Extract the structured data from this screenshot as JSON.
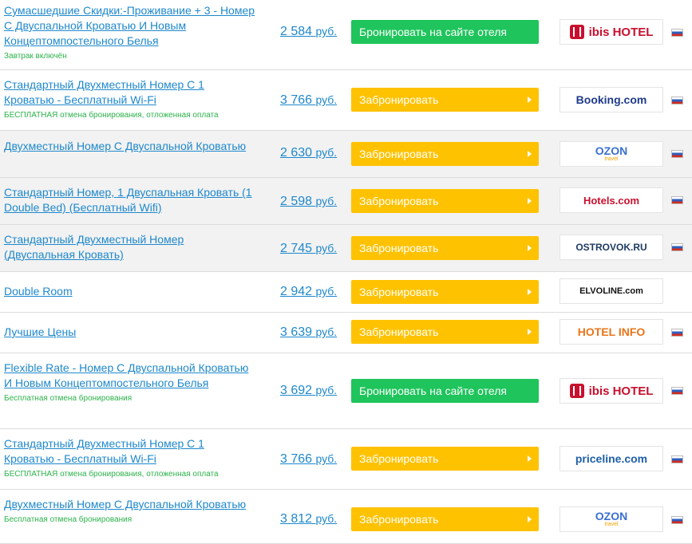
{
  "rows": [
    {
      "room": "Сумасшедшие Скидки:-Проживание + 3 - Номер С Двуспальной Кроватью И Новым Концептомпостельного Белья",
      "note": "Завтрак включён",
      "price": "2 584",
      "currency": "руб.",
      "button": "Бронировать на сайте отеля",
      "button_color": "#1fc45c",
      "logo": "ibis HOTEL",
      "logo_icon": "ibis-logo",
      "flag": true,
      "alt": false
    },
    {
      "room": "Стандартный Двухместный Номер С 1 Кроватью - Бесплатный Wi-Fi",
      "note": "БЕСПЛАТНАЯ отмена бронирования, отложенная оплата",
      "price": "3 766",
      "currency": "руб.",
      "button": "Забронировать",
      "button_color": "#ffc200",
      "logo": "Booking.com",
      "flag": true,
      "alt": false
    },
    {
      "room": "Двухместный Номер С Двуспальной Кроватью",
      "note": "",
      "price": "2 630",
      "currency": "руб.",
      "button": "Забронировать",
      "button_color": "#ffc200",
      "logo": "OZON",
      "logo_sub": "travel",
      "flag": true,
      "alt": true
    },
    {
      "room": "Стандартный Номер, 1 Двуспальная Кровать (1 Double Bed) (Бесплатный Wifi)",
      "note": "",
      "price": "2 598",
      "currency": "руб.",
      "button": "Забронировать",
      "button_color": "#ffc200",
      "logo": "Hotels.com",
      "flag": true,
      "alt": true
    },
    {
      "room": "Стандартный Двухместный Номер (Двуспальная Кровать)",
      "note": "",
      "price": "2 745",
      "currency": "руб.",
      "button": "Забронировать",
      "button_color": "#ffc200",
      "logo": "OSTROVOK.RU",
      "flag": true,
      "alt": true
    },
    {
      "room": "Double Room",
      "note": "",
      "price": "2 942",
      "currency": "руб.",
      "button": "Забронировать",
      "button_color": "#ffc200",
      "logo": "ELVOLINE.com",
      "flag": false,
      "alt": false
    },
    {
      "room": "Лучшие Цены",
      "note": "",
      "price": "3 639",
      "currency": "руб.",
      "button": "Забронировать",
      "button_color": "#ffc200",
      "logo": "HOTEL INFO",
      "flag": true,
      "alt": false
    },
    {
      "room": "Flexible Rate - Номер С Двуспальной Кроватью И Новым Концептомпостельного Белья",
      "note": "Бесплатная отмена бронирования",
      "price": "3 692",
      "currency": "руб.",
      "button": "Бронировать на сайте отеля",
      "button_color": "#1fc45c",
      "logo": "ibis HOTEL",
      "logo_icon": "ibis-logo",
      "flag": true,
      "alt": false
    },
    {
      "room": "Стандартный Двухместный Номер С 1 Кроватью - Бесплатный Wi-Fi",
      "note": "БЕСПЛАТНАЯ отмена бронирования, отложенная оплата",
      "price": "3 766",
      "currency": "руб.",
      "button": "Забронировать",
      "button_color": "#ffc200",
      "logo": "priceline.com",
      "flag": true,
      "alt": false
    },
    {
      "room": "Двухместный Номер С Двуспальной Кроватью",
      "note": "Бесплатная отмена бронирования",
      "price": "3 812",
      "currency": "руб.",
      "button": "Забронировать",
      "button_color": "#ffc200",
      "logo": "OZON",
      "logo_sub": "travel",
      "flag": true,
      "alt": false
    }
  ]
}
